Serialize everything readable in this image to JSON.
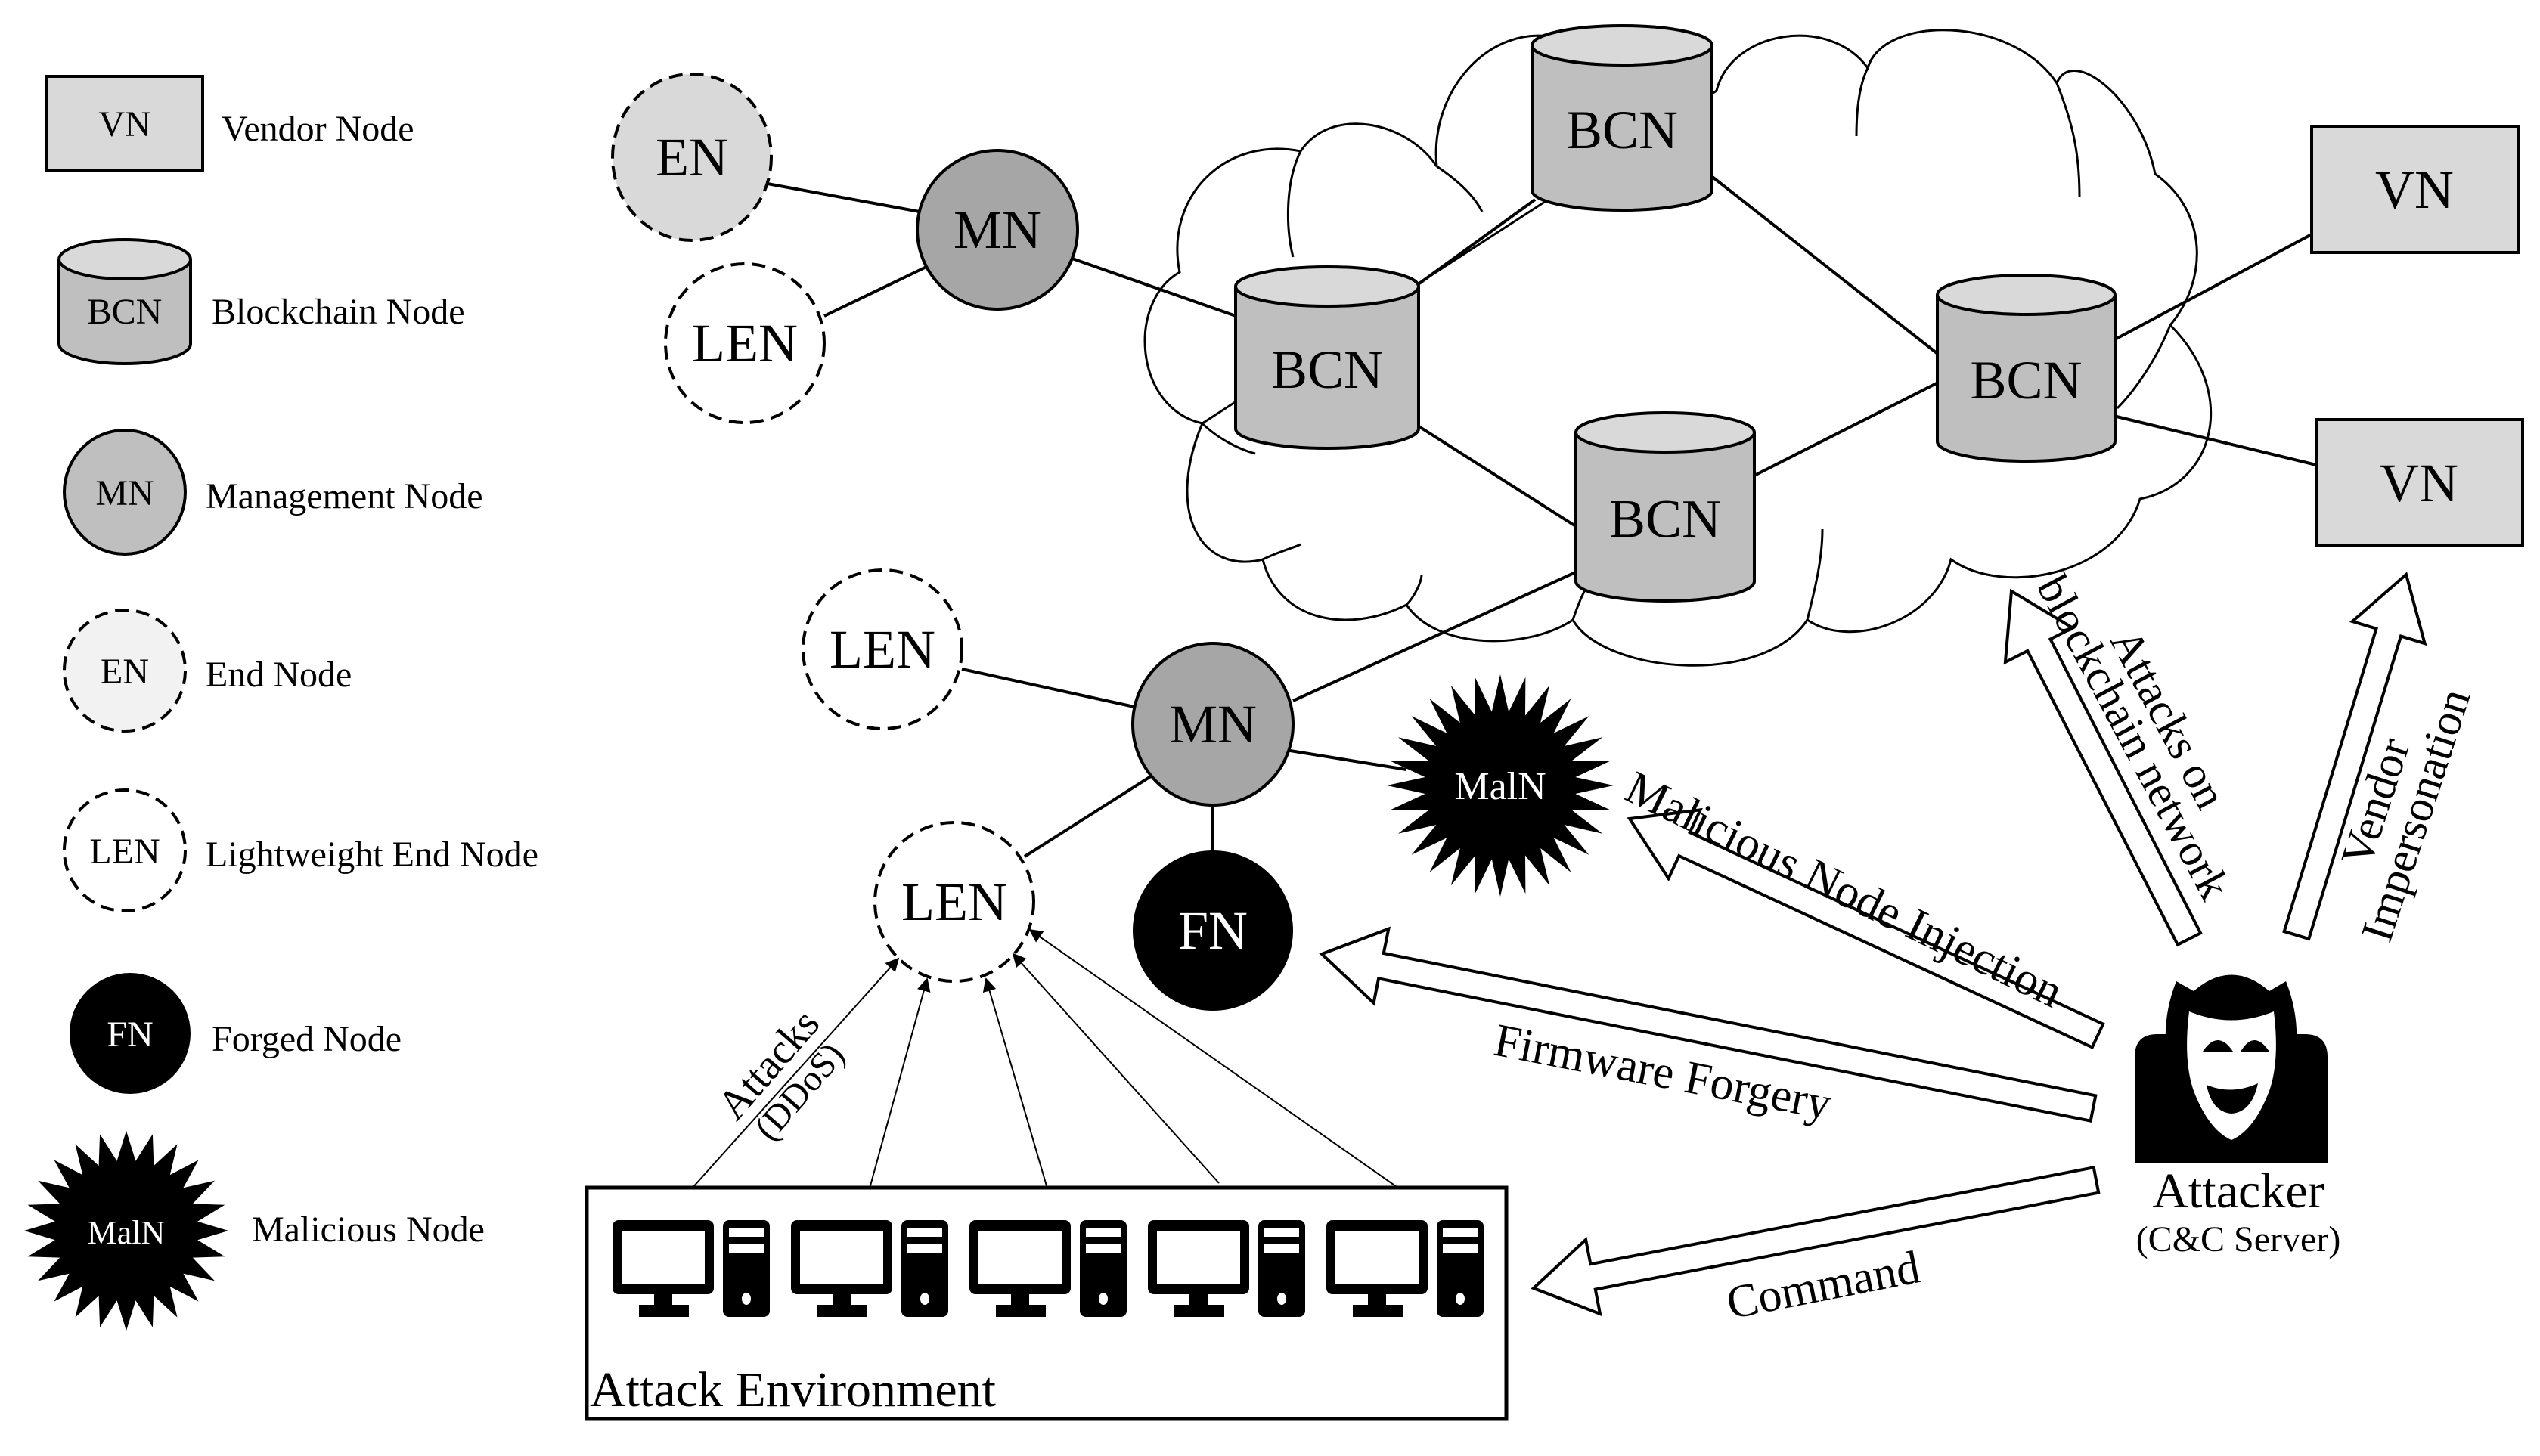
{
  "legend": {
    "items": [
      {
        "abbr": "VN",
        "label": "Vendor Node",
        "shape": "rectangle",
        "fill": "#d9d9d9"
      },
      {
        "abbr": "BCN",
        "label": "Blockchain Node",
        "shape": "cylinder",
        "fill": "#bfbfbf"
      },
      {
        "abbr": "MN",
        "label": "Management Node",
        "shape": "circle",
        "fill": "#a6a6a6"
      },
      {
        "abbr": "EN",
        "label": "End Node",
        "shape": "dashed-circle",
        "fill": "#f2f2f2"
      },
      {
        "abbr": "LEN",
        "label": "Lightweight End Node",
        "shape": "dashed-circle",
        "fill": "#ffffff"
      },
      {
        "abbr": "FN",
        "label": "Forged Node",
        "shape": "circle",
        "fill": "#000000"
      },
      {
        "abbr": "MalN",
        "label": "Malicious Node",
        "shape": "starburst",
        "fill": "#000000"
      }
    ]
  },
  "nodes": {
    "en_top": "EN",
    "len_top": "LEN",
    "mn_top": "MN",
    "bcn_left": "BCN",
    "bcn_top": "BCN",
    "bcn_right": "BCN",
    "bcn_bottom": "BCN",
    "vn_top": "VN",
    "vn_bottom": "VN",
    "len_mid": "LEN",
    "mn_mid": "MN",
    "maln": "MalN",
    "fn": "FN",
    "len_target": "LEN"
  },
  "attacker": {
    "title": "Attacker",
    "subtitle": "(C&C Server)"
  },
  "attack_environment": {
    "label": "Attack Environment",
    "computer_count": 5
  },
  "attacks": {
    "ddos_line1": "Attacks",
    "ddos_line2": "(DDoS)",
    "blockchain_line1": "Attacks on",
    "blockchain_line2": "blockchain network",
    "vendor_line1": "Vendor",
    "vendor_line2": "Impersonation",
    "malicious_injection": "Malicious Node Injection",
    "firmware_forgery": "Firmware Forgery",
    "command": "Command"
  },
  "colors": {
    "vn_fill": "#d9d9d9",
    "bcn_body": "#bfbfbf",
    "bcn_top": "#d9d9d9",
    "mn_fill": "#a6a6a6",
    "en_fill": "#d9d9d9",
    "legend_en_fill": "#f2f2f2",
    "dark": "#000000"
  }
}
